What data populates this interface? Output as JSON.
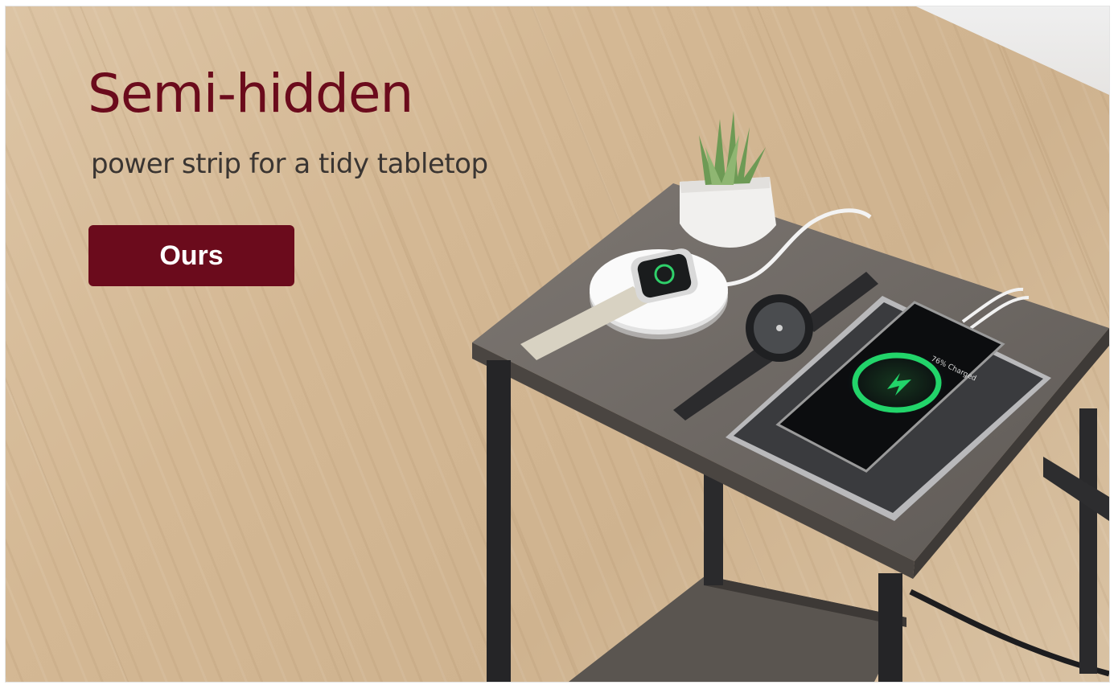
{
  "banner": {
    "headline": "Semi-hidden",
    "subheadline": "power strip for a tidy tabletop",
    "cta_label": "Ours"
  },
  "phone": {
    "charge_text": "76% Charged"
  },
  "colors": {
    "brand_maroon": "#6b0b1c",
    "subtext": "#3a3532",
    "charge_green": "#22d46a",
    "floor_wood": "#d4b894",
    "table_top": "#6f6a66"
  },
  "icons": [
    "lightning-bolt-icon"
  ]
}
